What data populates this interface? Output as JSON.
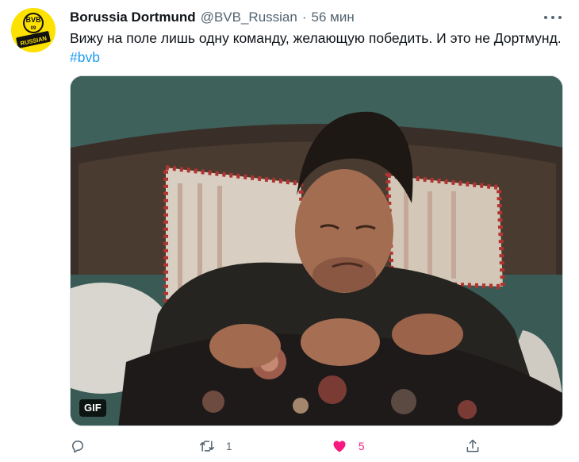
{
  "tweet": {
    "author": {
      "display_name": "Borussia Dortmund",
      "handle": "@BVB_Russian",
      "avatar_text_top": "BVB",
      "avatar_text_mid": "09",
      "avatar_text_bottom": "RUSSIAN",
      "avatar_color": "#fde100"
    },
    "separator": "·",
    "time": "56 мин",
    "text": "Вижу на поле лишь одну команду, желающую победить. И это не Дортмунд.",
    "hashtag": "#bvb",
    "media": {
      "badge": "GIF"
    },
    "actions": {
      "reply_icon": "reply-icon",
      "retweet_icon": "retweet-icon",
      "retweet_count": "1",
      "like_icon": "heart-icon",
      "like_count": "5",
      "like_color": "#f91880",
      "share_icon": "share-icon"
    },
    "more_icon": "more-icon",
    "accent_color": "#1d9bf0"
  }
}
